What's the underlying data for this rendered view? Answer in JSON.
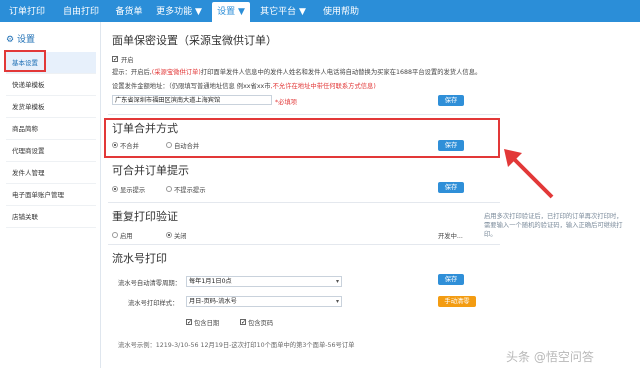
{
  "topnav": {
    "tabs": [
      {
        "label": "订单打印"
      },
      {
        "label": "自由打印"
      },
      {
        "label": "备货单"
      },
      {
        "label": "更多功能 ▼"
      },
      {
        "label": "设置 ▼"
      },
      {
        "label": "其它平台 ▼"
      },
      {
        "label": "使用帮助"
      }
    ]
  },
  "sidebar": {
    "title": "设置",
    "items": [
      {
        "label": "基本设置"
      },
      {
        "label": "快递单模板"
      },
      {
        "label": "发货单模板"
      },
      {
        "label": "商品简称"
      },
      {
        "label": "代理商设置"
      },
      {
        "label": "发件人管理"
      },
      {
        "label": "电子面单账户管理"
      },
      {
        "label": "店铺关联"
      }
    ]
  },
  "sections": {
    "privacy": {
      "title": "面单保密设置（采源宝微供订单）",
      "enable_label": "开启",
      "hint_prefix": "提示：开启后,",
      "hint_red": "(采源宝微供订单)",
      "hint_suffix": "打印面单发件人信息中的发件人姓名和发件人电话将自动替换为买家在1688平台设置的发货人信息。",
      "addr_label": "设置发件金额地址：（仍限填写普通地址信息 例xx省xx市",
      "addr_red": ",不允许在地址中带任何联系方式信息)",
      "addr_value": "广东省深圳市福田区滨南大道上海宾馆",
      "addr_required": "*必填项",
      "save": "保存"
    },
    "merge": {
      "title": "订单合并方式",
      "opt1": "不合并",
      "opt2": "自动合并",
      "save": "保存"
    },
    "mergeHint": {
      "title": "可合并订单提示",
      "opt1": "显示提示",
      "opt2": "不提示提示",
      "save": "保存"
    },
    "repeat": {
      "title": "重复打印验证",
      "opt1": "启用",
      "opt2": "关闭",
      "right_label": "开发中...",
      "side_note": "启用多次打印验证后，已打印的订单再次打印时，需要输入一个随机的验证码，输入正确后可继续打印。"
    },
    "serial": {
      "title": "流水号打印",
      "clear_label": "流水号自动清零周期：",
      "clear_value": "每年1月1日0点",
      "style_label": "流水号打印样式：",
      "style_value": "月日-页码-流水号",
      "save": "保存",
      "manual_clear": "手动清零",
      "chk1": "包含日期",
      "chk2": "包含页码",
      "example": "流水号示例：1219-3/10-56 12月19日-这次打印10个面单中的第3个面单-56号订单"
    }
  },
  "watermark": "头条 @悟空问答",
  "colors": {
    "nav": "#2b8ed8",
    "highlight": "#e23838",
    "button": "#2f8fd8"
  }
}
